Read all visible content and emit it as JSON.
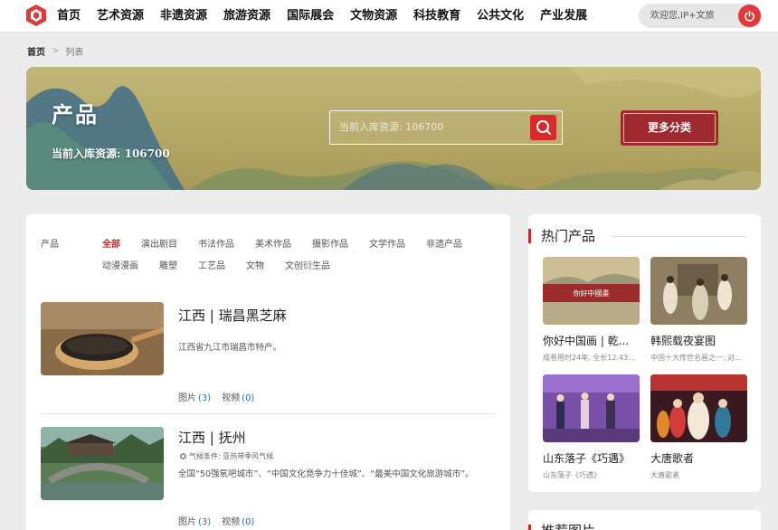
{
  "nav": {
    "items": [
      "首页",
      "艺术资源",
      "非遗资源",
      "旅游资源",
      "国际展会",
      "文物资源",
      "科技教育",
      "公共文化",
      "产业发展"
    ],
    "welcome": "欢迎您,IP+文旅"
  },
  "breadcrumb": {
    "home": "首页",
    "current": "列表"
  },
  "banner": {
    "title": "产品",
    "count_text": "当前入库资源: 106700",
    "search_placeholder": "当前入库资源: 106700",
    "more_label": "更多分类"
  },
  "filters": {
    "label": "产品",
    "row1": [
      "全部",
      "演出剧目",
      "书法作品",
      "美术作品",
      "摄影作品",
      "文学作品",
      "非遗产品"
    ],
    "row2": [
      "动漫漫画",
      "雕塑",
      "工艺品",
      "文物",
      "文创衍生品"
    ],
    "active": "全部"
  },
  "items": [
    {
      "title": "江西 | 瑞昌黑芝麻",
      "desc": "江西省九江市瑞昌市特产。",
      "climate": "",
      "photos_label": "图片",
      "photos": "(3)",
      "videos_label": "视频",
      "videos": "(0)"
    },
    {
      "title": "江西 | 抚州",
      "desc": "全国“50强氧吧城市”、“中国文化竞争力十佳城”、“最美中国文化旅游城市”。",
      "climate": "气候条件: 亚热带季风气候",
      "photos_label": "图片",
      "photos": "(3)",
      "videos_label": "视频",
      "videos": "(0)"
    }
  ],
  "hot": {
    "title": "热门产品",
    "items": [
      {
        "name": "你好中国画 | 乾...",
        "sub": "成卷用时24年, 全长12.43...",
        "img_text": "你好中國畫"
      },
      {
        "name": "韩熙载夜宴图",
        "sub": "中国十大传世名画之一, 对..."
      },
      {
        "name": "山东落子《巧遇》",
        "sub": "山东落子《巧遇》"
      },
      {
        "name": "大唐歌者",
        "sub": "大唐歌者"
      }
    ]
  },
  "recommend": {
    "title": "推荐图片"
  },
  "colors": {
    "accent": "#c62b2b",
    "link": "#2a6fb3",
    "banner_gold": "#b9a866",
    "more_btn": "#9e2a2f"
  }
}
